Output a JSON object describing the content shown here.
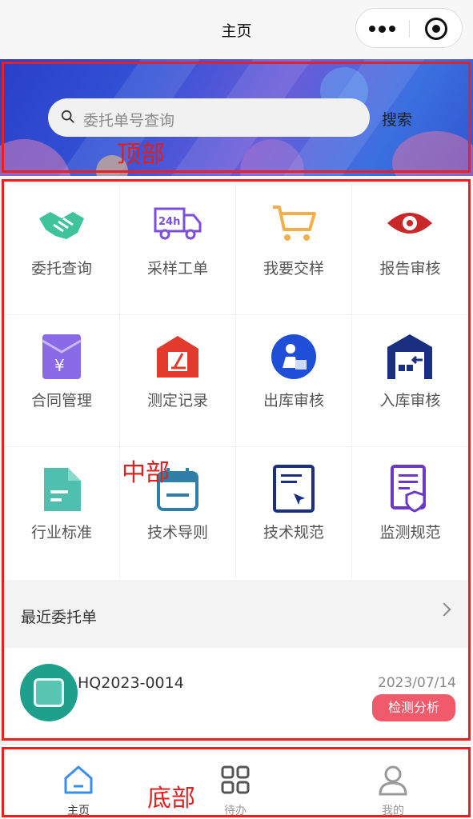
{
  "nav": {
    "title": "主页"
  },
  "banner": {
    "search_placeholder": "委托单号查询",
    "search_button": "搜索",
    "section_label": "顶部"
  },
  "menu": {
    "section_label": "中部",
    "items": [
      {
        "label": "委托查询",
        "icon": "handshake-icon"
      },
      {
        "label": "采样工单",
        "icon": "truck-24h-icon"
      },
      {
        "label": "我要交样",
        "icon": "shopping-cart-icon"
      },
      {
        "label": "报告审核",
        "icon": "eye-icon"
      },
      {
        "label": "合同管理",
        "icon": "envelope-yuan-icon"
      },
      {
        "label": "测定记录",
        "icon": "microscope-icon"
      },
      {
        "label": "出库审核",
        "icon": "delivery-person-icon"
      },
      {
        "label": "入库审核",
        "icon": "warehouse-in-icon"
      },
      {
        "label": "行业标准",
        "icon": "document-icon"
      },
      {
        "label": "技术导则",
        "icon": "calendar-icon"
      },
      {
        "label": "技术规范",
        "icon": "edit-document-icon"
      },
      {
        "label": "监测规范",
        "icon": "shield-document-icon"
      }
    ]
  },
  "recent": {
    "title": "最近委托单",
    "items": [
      {
        "code": "HQ2023-0014",
        "date": "2023/07/14",
        "status": "检测分析"
      }
    ]
  },
  "tabbar": {
    "section_label": "底部",
    "tabs": [
      {
        "label": "主页",
        "icon": "home-icon"
      },
      {
        "label": "待办",
        "icon": "grid-icon"
      },
      {
        "label": "我的",
        "icon": "user-icon"
      }
    ]
  },
  "colors": {
    "annotation_red": "#e82020",
    "brand_blue": "#2f55cf",
    "tag_red": "#ef5b6b"
  }
}
